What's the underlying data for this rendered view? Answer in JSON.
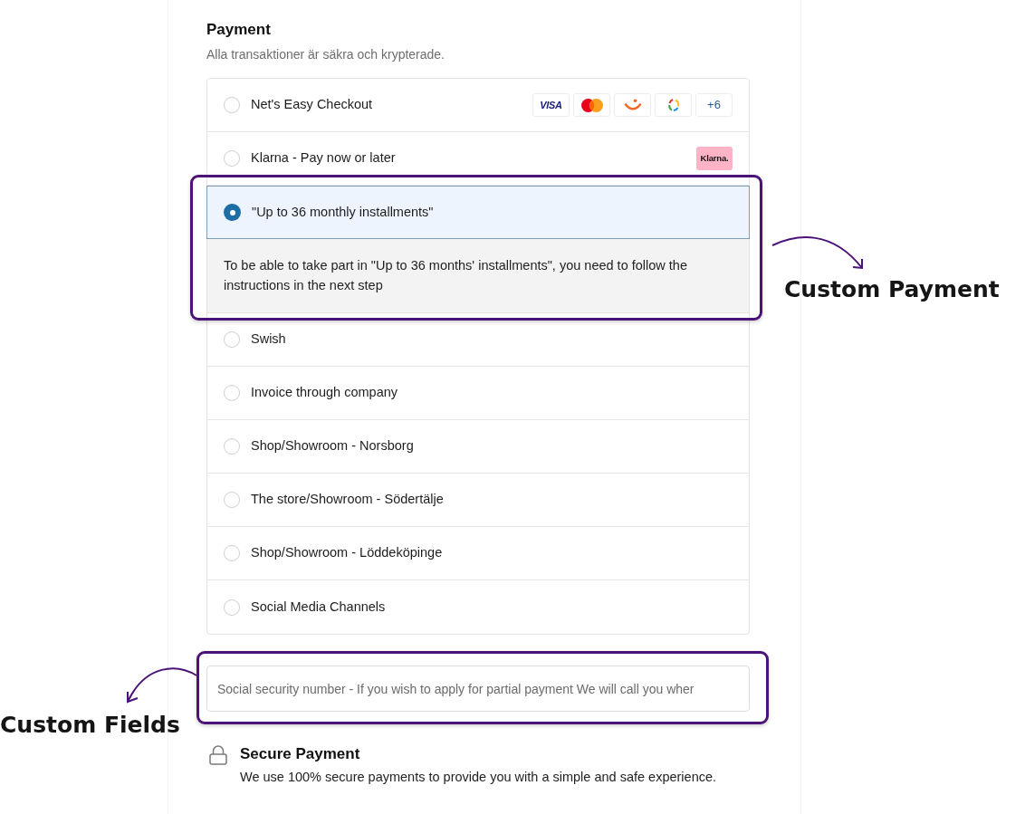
{
  "section": {
    "title": "Payment",
    "subtitle": "Alla transaktioner är säkra och krypterade."
  },
  "options": [
    {
      "label": "Net's Easy Checkout",
      "selected": false,
      "badges": [
        {
          "kind": "visa",
          "label": "VISA"
        },
        {
          "kind": "mastercard"
        },
        {
          "kind": "smile"
        },
        {
          "kind": "ring"
        },
        {
          "kind": "more",
          "label": "+6"
        }
      ]
    },
    {
      "label": "Klarna - Pay now or later",
      "selected": false,
      "badges": [
        {
          "kind": "klarna",
          "label": "Klarna."
        }
      ]
    },
    {
      "label": "\"Up to 36 monthly installments\"",
      "selected": true,
      "description": "To be able to take part in \"Up to 36 months' installments\", you need to follow the instructions in the next step"
    },
    {
      "label": "Swish",
      "selected": false
    },
    {
      "label": "Invoice through company",
      "selected": false
    },
    {
      "label": "Shop/Showroom - Norsborg",
      "selected": false
    },
    {
      "label": "The store/Showroom - Södertälje",
      "selected": false
    },
    {
      "label": "Shop/Showroom - Löddeköpinge",
      "selected": false
    },
    {
      "label": "Social Media Channels",
      "selected": false
    }
  ],
  "custom_field": {
    "placeholder": "Social security number - If you wish to apply for partial payment We will call you wher"
  },
  "secure_note": {
    "title": "Secure Payment",
    "text": "We use 100% secure payments to provide you with a simple and safe experience."
  },
  "annotations": [
    {
      "kind": "payment",
      "label": "Custom Payment"
    },
    {
      "kind": "fields",
      "label": "Custom Fields"
    }
  ]
}
